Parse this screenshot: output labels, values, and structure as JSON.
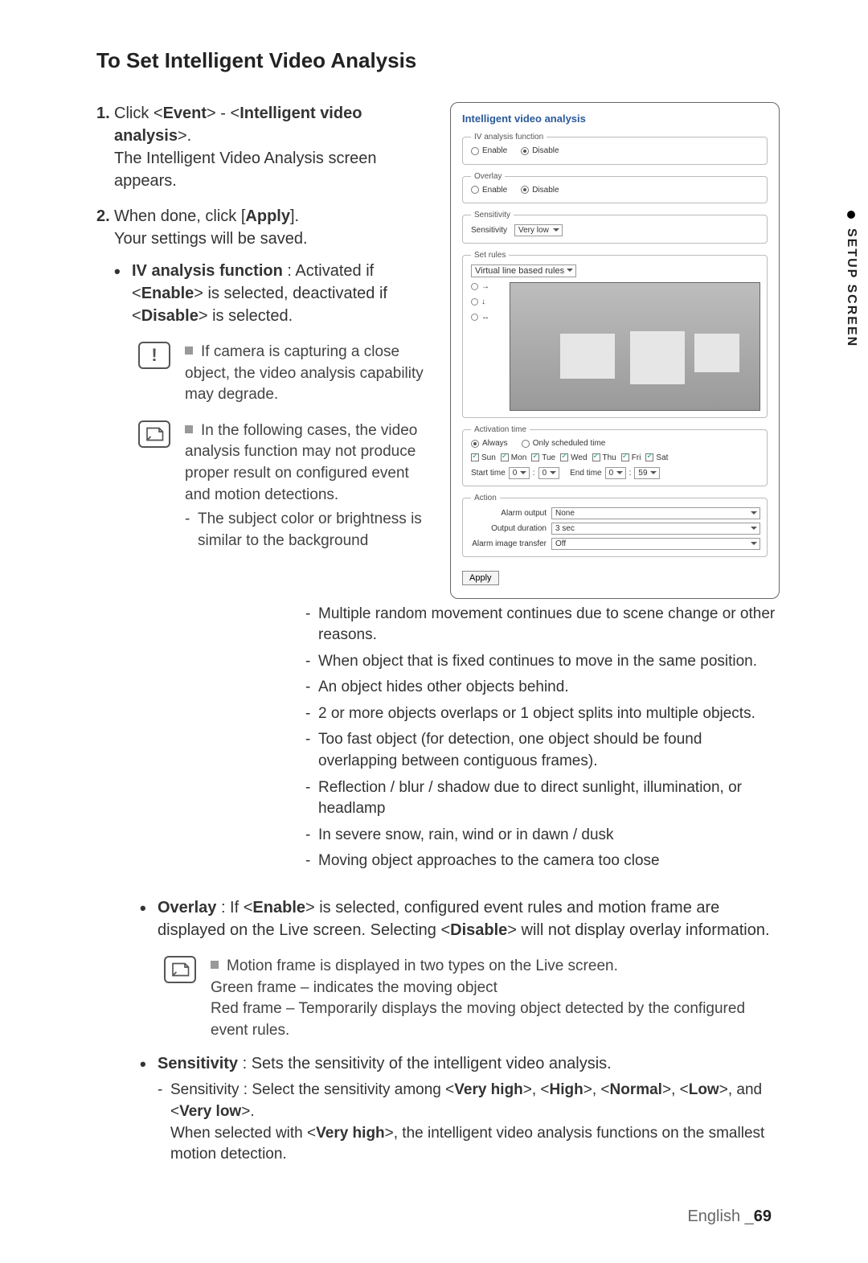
{
  "sideTab": {
    "label": "SETUP SCREEN"
  },
  "title": "To Set Intelligent Video Analysis",
  "step1": {
    "pre": "Click <",
    "b1": "Event",
    "mid": "> - <",
    "b2": "Intelligent video analysis",
    "post": ">.",
    "line2": "The Intelligent Video Analysis screen appears."
  },
  "step2": {
    "pre": "When done, click [",
    "b": "Apply",
    "post": "].",
    "line2": "Your settings will be saved."
  },
  "ivFunc": {
    "label": "IV analysis function",
    "colon": " : Activated if <",
    "en": "Enable",
    "mid": "> is selected, deactivated if <",
    "dis": "Disable",
    "post": "> is selected."
  },
  "warnNote": "If camera is capturing a close object, the video analysis capability may degrade.",
  "limitIntro": "In the following cases, the video analysis function may not produce proper result on configured event and motion detections.",
  "limits": [
    "The subject color or brightness is similar to the background",
    "Multiple random movement continues due to scene change or other reasons.",
    "When object that is fixed continues to move in the same position.",
    "An object hides other objects behind.",
    "2 or more objects overlaps or 1 object splits into multiple objects.",
    "Too fast object (for detection, one object should be found overlapping between contiguous frames).",
    "Reflection / blur / shadow due to direct sunlight, illumination, or headlamp",
    "In severe snow, rain, wind or in dawn / dusk",
    "Moving object approaches to the camera too close"
  ],
  "overlay": {
    "label": "Overlay",
    "pre": " : If <",
    "en": "Enable",
    "mid": "> is selected, configured event rules and motion frame are displayed on the Live screen. Selecting <",
    "dis": "Disable",
    "post": "> will not display overlay information."
  },
  "overlayNote": {
    "l1": "Motion frame is displayed in two types on the Live screen.",
    "l2": "Green frame – indicates the moving object",
    "l3": "Red frame – Temporarily displays the moving object detected by the configured event rules."
  },
  "sensitivity": {
    "label": "Sensitivity",
    "desc": " : Sets the sensitivity of the intelligent video analysis.",
    "sub_pre": "Sensitivity : Select the sensitivity among <",
    "vh": "Very high",
    "c1": ">, <",
    "h": "High",
    "c2": ">, <",
    "n": "Normal",
    "c3": ">, <",
    "l": "Low",
    "c4": ">, and <",
    "vl": "Very low",
    "c5": ">.",
    "sub2_pre": "When selected with <",
    "sub2_b": "Very high",
    "sub2_post": ">, the intelligent video analysis functions on the smallest motion detection."
  },
  "panel": {
    "title": "Intelligent video analysis",
    "g1": {
      "legend": "IV analysis function",
      "enable": "Enable",
      "disable": "Disable"
    },
    "g2": {
      "legend": "Overlay",
      "enable": "Enable",
      "disable": "Disable"
    },
    "g3": {
      "legend": "Sensitivity",
      "label": "Sensitivity",
      "value": "Very low"
    },
    "g4": {
      "legend": "Set rules",
      "value": "Virtual line based rules",
      "r1": "→",
      "r2": "↓",
      "r3": "↔"
    },
    "g5": {
      "legend": "Activation time",
      "always": "Always",
      "sched": "Only scheduled time",
      "days": [
        "Sun",
        "Mon",
        "Tue",
        "Wed",
        "Thu",
        "Fri",
        "Sat"
      ],
      "startLbl": "Start time",
      "endLbl": "End time",
      "sh": "0",
      "sm": "0",
      "eh": "0",
      "em": "59",
      "colon": ":"
    },
    "g6": {
      "legend": "Action",
      "l1": "Alarm output",
      "v1": "None",
      "l2": "Output duration",
      "v2": "3 sec",
      "l3": "Alarm image transfer",
      "v3": "Off"
    },
    "apply": "Apply"
  },
  "footer": {
    "lang": "English _",
    "page": "69"
  }
}
